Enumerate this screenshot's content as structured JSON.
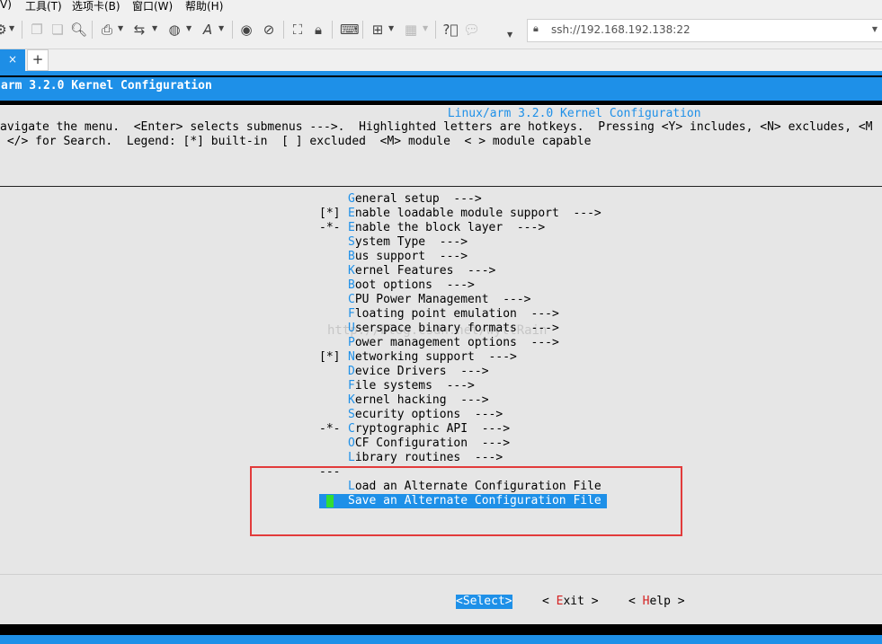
{
  "menubar": {
    "items": [
      "V)",
      "工具(T)",
      "选项卡(B)",
      "窗口(W)",
      "帮助(H)"
    ]
  },
  "address": {
    "value": "ssh://192.168.192.138:22"
  },
  "tabs": {
    "close_label": "×",
    "add_label": "+"
  },
  "terminal": {
    "app_title": "arm 3.2.0 Kernel Configuration",
    "dialog_title": " Linux/arm 3.2.0 Kernel Configuration ",
    "help_line_1": "avigate the menu.  <Enter> selects submenus --->.  Highlighted letters are hotkeys.  Pressing <Y> includes, <N> excludes, <M",
    "help_line_2": " </> for Search.  Legend: [*] built-in  [ ] excluded  <M> module  < > module capable",
    "menu_items": [
      {
        "mark": "",
        "hotkey": "G",
        "rest": "eneral setup  --->"
      },
      {
        "mark": "[*]",
        "hotkey": "E",
        "rest": "nable loadable module support  --->"
      },
      {
        "mark": "-*-",
        "hotkey": "E",
        "rest": "nable the block layer  --->"
      },
      {
        "mark": "",
        "hotkey": "S",
        "rest": "ystem Type  --->"
      },
      {
        "mark": "",
        "hotkey": "B",
        "rest": "us support  --->"
      },
      {
        "mark": "",
        "hotkey": "K",
        "rest": "ernel Features  --->"
      },
      {
        "mark": "",
        "hotkey": "B",
        "rest": "oot options  --->"
      },
      {
        "mark": "",
        "hotkey": "C",
        "rest": "PU Power Management  --->"
      },
      {
        "mark": "",
        "hotkey": "F",
        "rest": "loating point emulation  --->"
      },
      {
        "mark": "",
        "hotkey": "U",
        "rest": "serspace binary formats  --->"
      },
      {
        "mark": "",
        "hotkey": "P",
        "rest": "ower management options  --->"
      },
      {
        "mark": "[*]",
        "hotkey": "N",
        "rest": "etworking support  --->"
      },
      {
        "mark": "",
        "hotkey": "D",
        "rest": "evice Drivers  --->"
      },
      {
        "mark": "",
        "hotkey": "F",
        "rest": "ile systems  --->"
      },
      {
        "mark": "",
        "hotkey": "K",
        "rest": "ernel hacking  --->"
      },
      {
        "mark": "",
        "hotkey": "S",
        "rest": "ecurity options  --->"
      },
      {
        "mark": "-*-",
        "hotkey": "C",
        "rest": "ryptographic API  --->"
      },
      {
        "mark": "",
        "hotkey": "O",
        "rest": "CF Configuration  --->"
      },
      {
        "mark": "",
        "hotkey": "L",
        "rest": "ibrary routines  --->"
      }
    ],
    "separator": "---",
    "load_item": {
      "hotkey": "L",
      "rest": "oad an Alternate Configuration File"
    },
    "save_item": {
      "hotkey": "S",
      "rest": "ave an Alternate Configuration File"
    },
    "buttons": {
      "select": "<Select>",
      "exit_pre": "< ",
      "exit_hk": "E",
      "exit_rest": "xit >",
      "help_pre": "< ",
      "help_hk": "H",
      "help_rest": "elp >"
    },
    "watermark": "http://blog.csdn.net/wyttRain"
  }
}
